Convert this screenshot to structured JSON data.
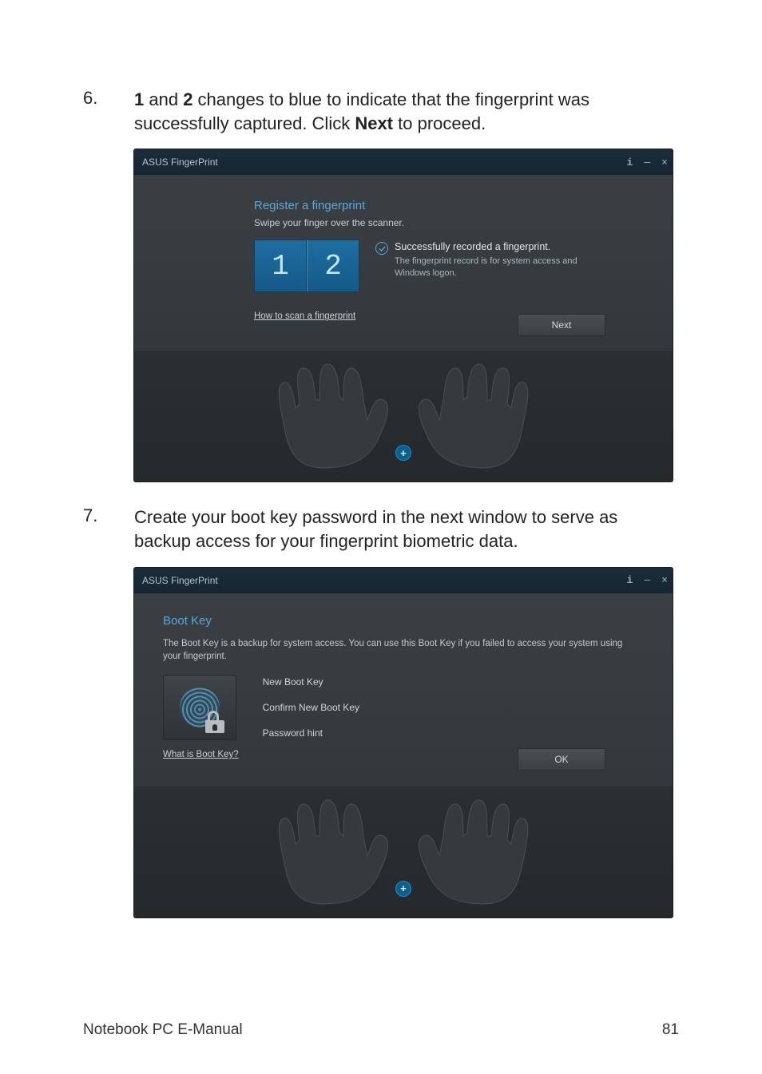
{
  "steps": {
    "s6": {
      "num": "6.",
      "text_prefix": "",
      "bold1": "1",
      "text_mid1": " and ",
      "bold2": "2",
      "text_mid2": " changes to blue to indicate that the fingerprint was successfully captured. Click ",
      "bold3": "Next",
      "text_suffix": " to proceed."
    },
    "s7": {
      "num": "7.",
      "text": "Create your boot key password in the next window to serve as backup access for your fingerprint biometric data."
    }
  },
  "screenshot1": {
    "titlebar": {
      "title": "ASUS FingerPrint",
      "info": "i",
      "min": "—",
      "close": "×"
    },
    "heading": "Register a fingerprint",
    "subheading": "Swipe your finger over the scanner.",
    "digits": [
      "1",
      "2"
    ],
    "status_title": "Successfully recorded a fingerprint.",
    "status_desc": "The fingerprint record is for system access and Windows logon.",
    "how_link": "How to scan a fingerprint",
    "next_label": "Next",
    "plus": "+"
  },
  "screenshot2": {
    "titlebar": {
      "title": "ASUS FingerPrint",
      "info": "i",
      "min": "—",
      "close": "×"
    },
    "heading": "Boot Key",
    "desc": "The Boot Key is a backup for system access. You can use this Boot Key if you failed to access your system using your fingerprint.",
    "fields": {
      "new": "New Boot Key",
      "confirm": "Confirm New Boot Key",
      "hint": "Password hint"
    },
    "what_link": "What is Boot Key?",
    "ok_label": "OK",
    "plus": "+"
  },
  "footer": {
    "left": "Notebook PC E-Manual",
    "right": "81"
  }
}
